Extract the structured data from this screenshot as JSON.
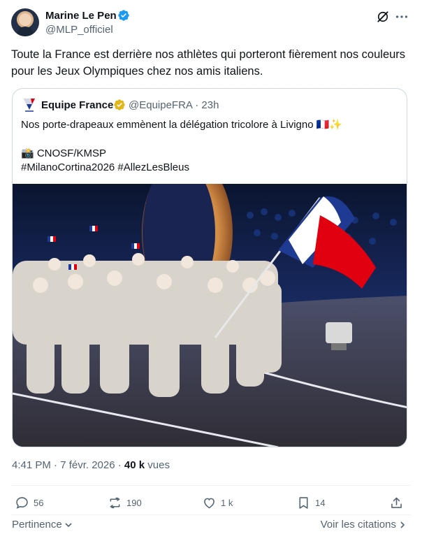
{
  "author": {
    "name": "Marine Le Pen",
    "handle": "@MLP_officiel"
  },
  "tweet": {
    "text": "Toute la France est derrière nos athlètes qui porteront fièrement nos couleurs pour les Jeux Olympiques chez nos amis italiens."
  },
  "quote": {
    "name": "Equipe France",
    "handle_time": "@EquipeFRA · 23h",
    "line1": "Nos porte-drapeaux emmènent la délégation tricolore à Livigno 🇫🇷✨",
    "line2": "📸 CNOSF/KMSP",
    "line3": "#MilanoCortina2026 #AllezLesBleus"
  },
  "meta": {
    "time": "4:41 PM · 7 févr. 2026 · ",
    "views_count": "40 k",
    "views_label": " vues"
  },
  "actions": {
    "replies": "56",
    "reposts": "190",
    "likes": "1 k",
    "bookmarks": "14"
  },
  "footer": {
    "sort_label": "Pertinence",
    "quotes_link": "Voir les citations"
  },
  "colors": {
    "verified_blue": "#1d9bf0",
    "verified_gold": "#e2b719",
    "muted": "#536471",
    "border": "#cfd9de"
  }
}
